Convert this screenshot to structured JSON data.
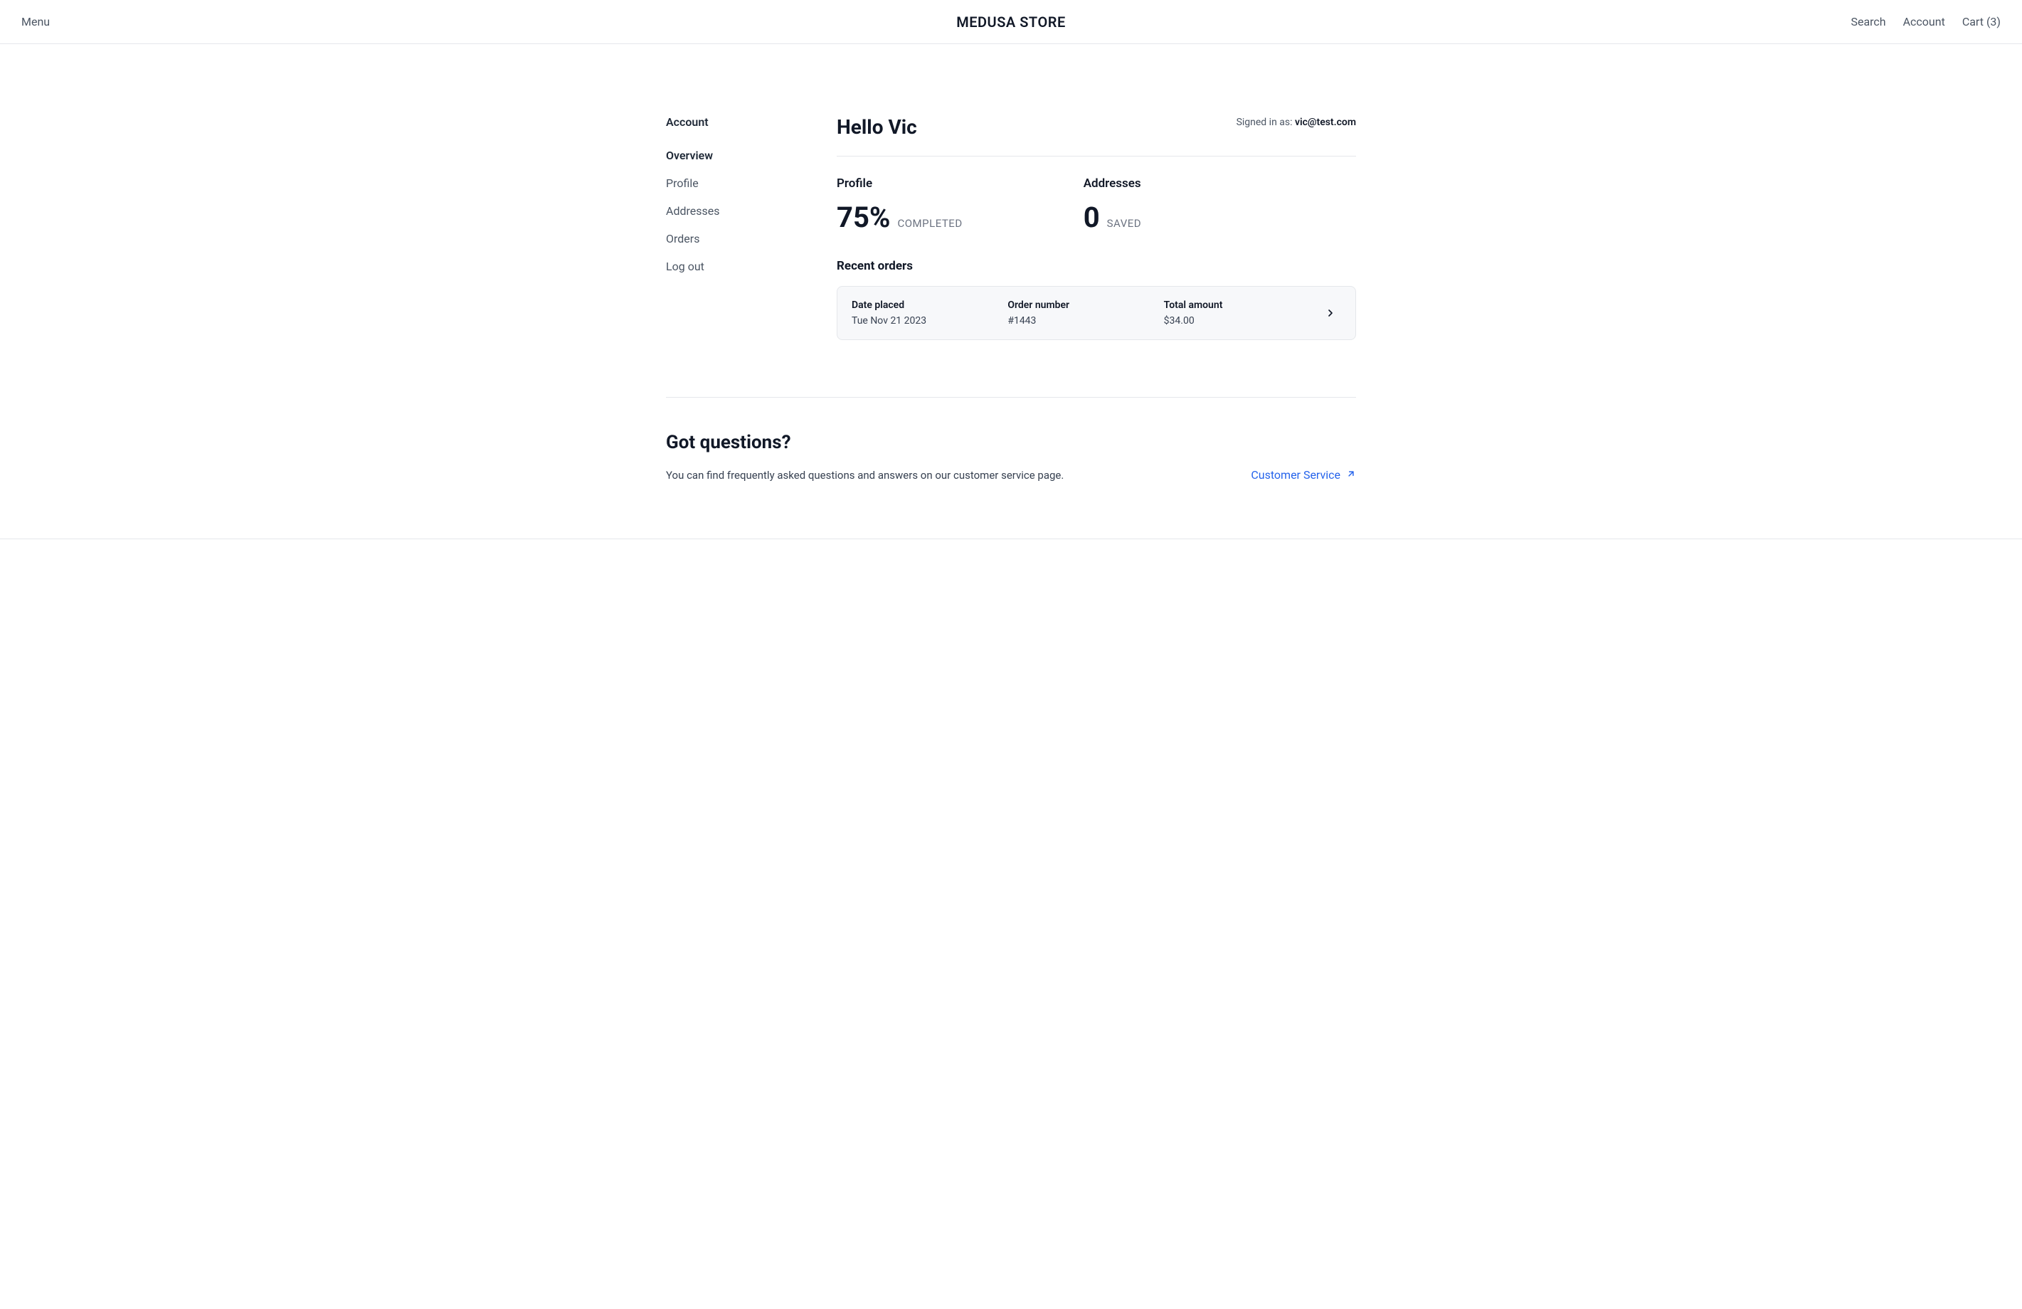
{
  "header": {
    "menu": "Menu",
    "brand": "MEDUSA STORE",
    "search": "Search",
    "account": "Account",
    "cart": "Cart (3)"
  },
  "sidebar": {
    "title": "Account",
    "items": [
      {
        "label": "Overview",
        "active": true
      },
      {
        "label": "Profile",
        "active": false
      },
      {
        "label": "Addresses",
        "active": false
      },
      {
        "label": "Orders",
        "active": false
      },
      {
        "label": "Log out",
        "active": false
      }
    ]
  },
  "overview": {
    "hello": "Hello Vic",
    "signed_in_prefix": "Signed in as: ",
    "signed_in_email": "vic@test.com",
    "profile": {
      "title": "Profile",
      "value": "75%",
      "sub": "COMPLETED"
    },
    "addresses": {
      "title": "Addresses",
      "value": "0",
      "sub": "SAVED"
    },
    "recent_orders_title": "Recent orders",
    "orders": [
      {
        "date_label": "Date placed",
        "date_value": "Tue Nov 21 2023",
        "number_label": "Order number",
        "number_value": "#1443",
        "total_label": "Total amount",
        "total_value": "$34.00"
      }
    ]
  },
  "questions": {
    "title": "Got questions?",
    "body": "You can find frequently asked questions and answers on our customer service page.",
    "link": "Customer Service"
  }
}
